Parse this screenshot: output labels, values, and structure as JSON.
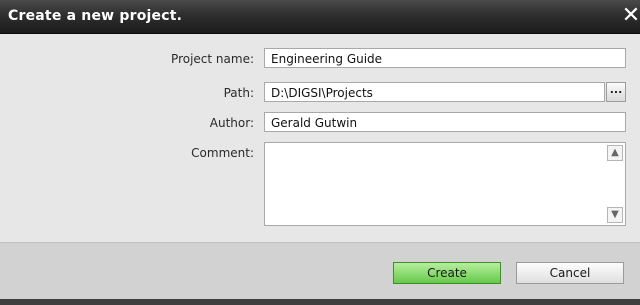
{
  "dialog": {
    "title": "Create a new project.",
    "close_glyph": "✕"
  },
  "form": {
    "project_name_label": "Project name:",
    "project_name_value": "Engineering Guide",
    "path_label": "Path:",
    "path_value": "D:\\DIGSI\\Projects",
    "browse_label": "...",
    "author_label": "Author:",
    "author_value": "Gerald Gutwin",
    "comment_label": "Comment:",
    "comment_value": ""
  },
  "buttons": {
    "create": "Create",
    "cancel": "Cancel"
  },
  "colors": {
    "titlebar": "#2f2f2f",
    "dialog_bg": "#e7e7e7",
    "footer_bg": "#d2d2d2",
    "create_accent": "#66c94a"
  },
  "icons": {
    "close": "close-icon",
    "scroll_up": "scroll-up-icon",
    "scroll_down": "scroll-down-icon"
  }
}
